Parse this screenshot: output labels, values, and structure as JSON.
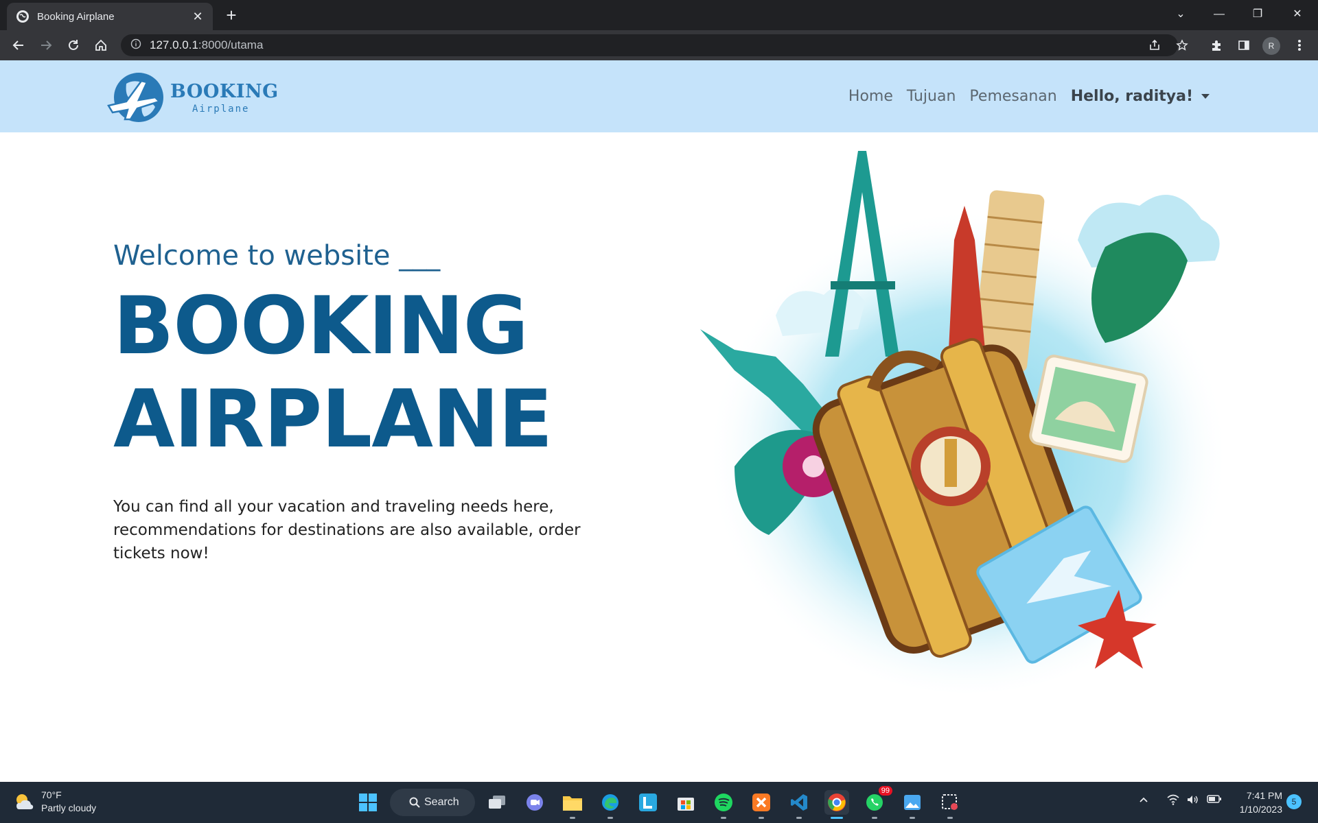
{
  "browser": {
    "tab_title": "Booking Airplane",
    "url_host": "127.0.0.1",
    "url_rest": ":8000/utama",
    "profile_initial": "R"
  },
  "navbar": {
    "logo_brand": "BOOKING",
    "logo_sub": "Airplane",
    "links": [
      "Home",
      "Tujuan",
      "Pemesanan"
    ],
    "user_menu": "Hello, raditya!"
  },
  "hero": {
    "welcome": "Welcome to website ___",
    "headline_line1": "BOOKING",
    "headline_line2": "AIRPLANE",
    "description": "You can find all your vacation and traveling needs here, recommendations for destinations are also available, order tickets now!"
  },
  "taskbar": {
    "weather_temp": "70°F",
    "weather_desc": "Partly cloudy",
    "search_label": "Search",
    "whatsapp_badge": "99",
    "time": "7:41 PM",
    "date": "1/10/2023",
    "notification_count": "5"
  },
  "colors": {
    "navbar_bg": "#c5e3fa",
    "headline": "#0d5a8c",
    "logo": "#2a7ab7"
  }
}
